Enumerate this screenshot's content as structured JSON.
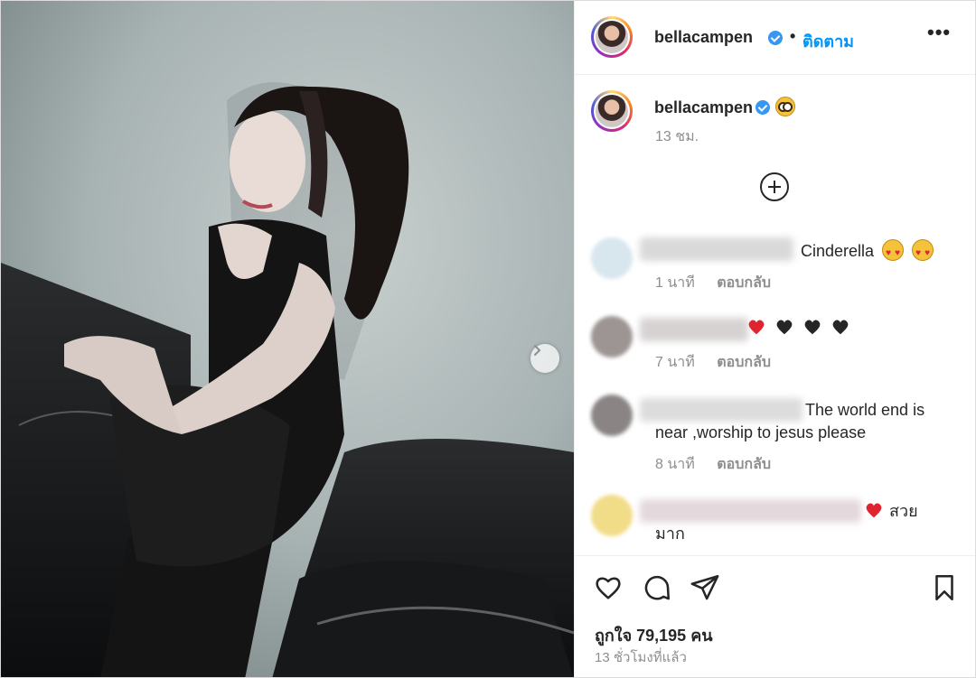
{
  "post": {
    "username": "bellacampen",
    "follow_label": "ติดตาม",
    "separator": "•",
    "more_label": "•••"
  },
  "caption": {
    "username": "bellacampen",
    "time": "13 ชม."
  },
  "comments": [
    {
      "text": "Cinderella",
      "emoji": [
        "heart-eyes-emoji",
        "heart-eyes-emoji"
      ],
      "time": "1 นาที",
      "reply": "ตอบกลับ"
    },
    {
      "text": "",
      "emoji": [
        "red-heart-emoji",
        "black-heart-emoji",
        "black-heart-emoji",
        "black-heart-emoji"
      ],
      "time": "7 นาที",
      "reply": "ตอบกลับ"
    },
    {
      "text_line1": "The world end is",
      "text_line2": "near ,worship to jesus please",
      "time": "8 นาที",
      "reply": "ตอบกลับ"
    },
    {
      "text_line1": "สวย",
      "text_line2": "มาก",
      "emoji": [
        "red-heart-emoji"
      ]
    }
  ],
  "stats": {
    "likes": "ถูกใจ 79,195 คน",
    "posted_ago": "13 ชั่วโมงที่แล้ว"
  },
  "icons": [
    "heart-icon",
    "comment-icon",
    "share-icon",
    "bookmark-icon",
    "add-icon",
    "next-arrow-icon",
    "verified-icon"
  ],
  "colors": {
    "link": "#0095f6",
    "verified": "#3897f0",
    "meta": "#8e8e8e"
  }
}
